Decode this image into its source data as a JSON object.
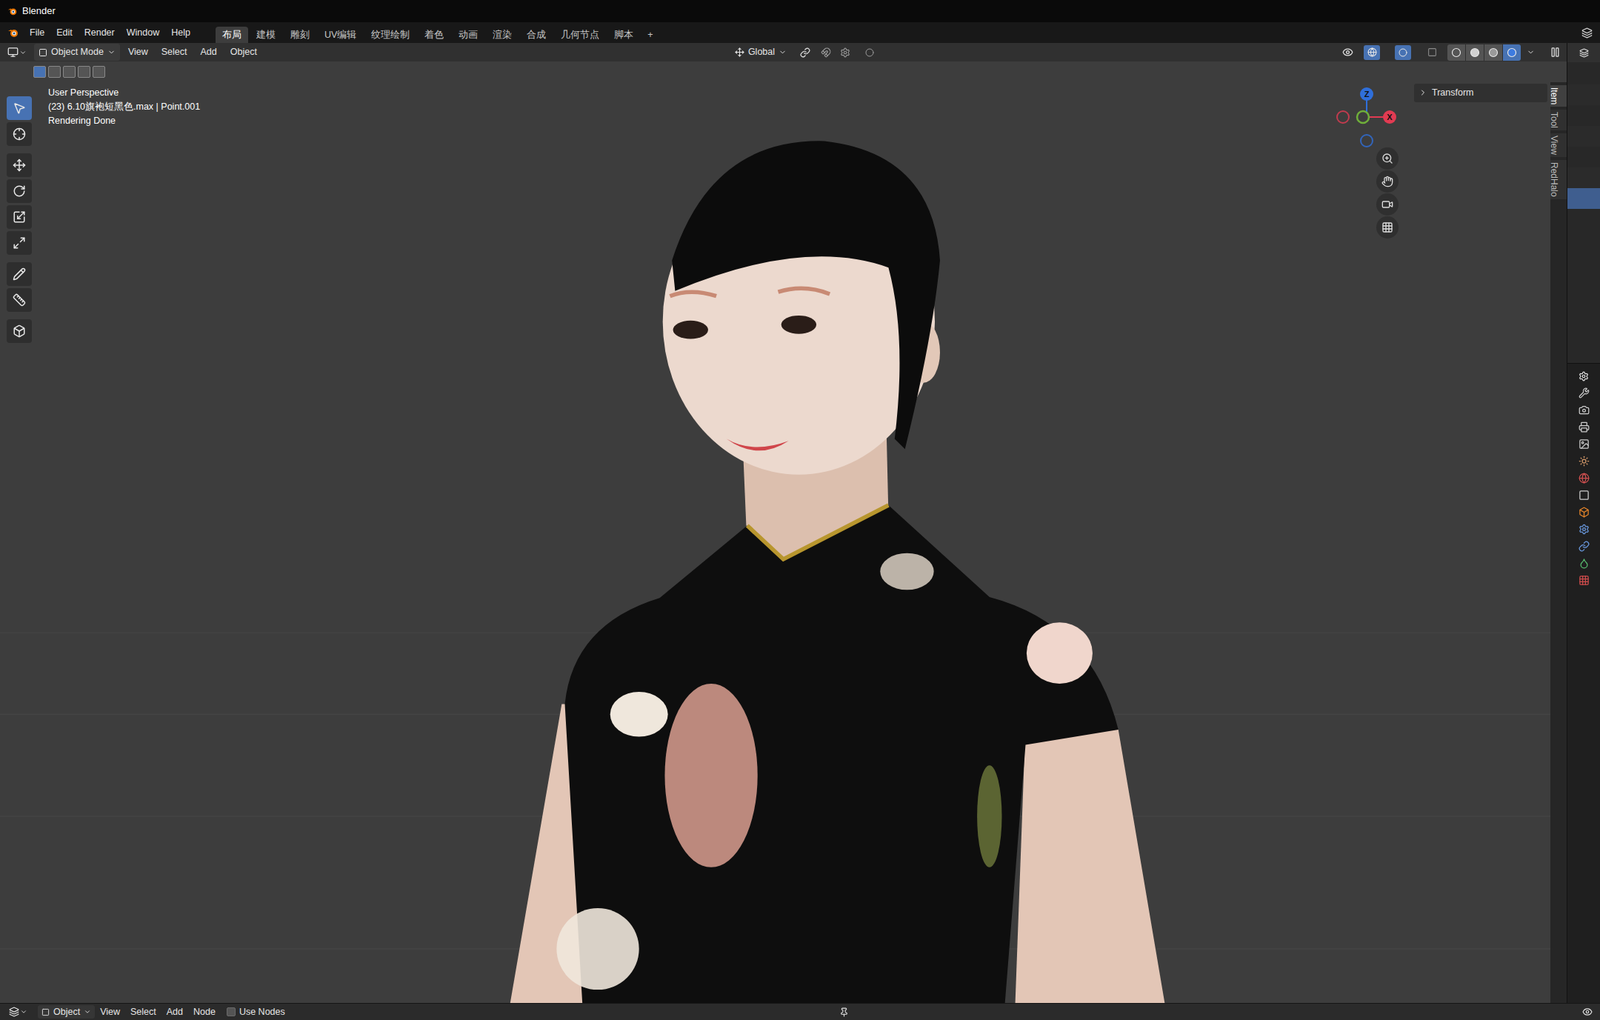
{
  "window": {
    "title": "Blender"
  },
  "menu": [
    "File",
    "Edit",
    "Render",
    "Window",
    "Help"
  ],
  "workspaces": [
    {
      "label": "布局",
      "selected": true
    },
    {
      "label": "建模",
      "selected": false
    },
    {
      "label": "雕刻",
      "selected": false
    },
    {
      "label": "UV编辑",
      "selected": false
    },
    {
      "label": "纹理绘制",
      "selected": false
    },
    {
      "label": "着色",
      "selected": false
    },
    {
      "label": "动画",
      "selected": false
    },
    {
      "label": "渲染",
      "selected": false
    },
    {
      "label": "合成",
      "selected": false
    },
    {
      "label": "几何节点",
      "selected": false
    },
    {
      "label": "脚本",
      "selected": false
    }
  ],
  "add_workspace": "+",
  "viewport_header": {
    "mode": "Object Mode",
    "menus": [
      "View",
      "Select",
      "Add",
      "Object"
    ],
    "orientation": "Global",
    "options": "Options",
    "shading": [
      {
        "kind": "wireframe",
        "selected": false
      },
      {
        "kind": "solid",
        "selected": false
      },
      {
        "kind": "material",
        "selected": false
      },
      {
        "kind": "rendered",
        "selected": true
      }
    ]
  },
  "select_modes": [
    {
      "selected": true
    },
    {
      "selected": false
    },
    {
      "selected": false
    },
    {
      "selected": false
    },
    {
      "selected": false
    }
  ],
  "tools": [
    {
      "kind": "select",
      "selected": true
    },
    {
      "kind": "cursor",
      "selected": false
    },
    {
      "kind": "move",
      "selected": false
    },
    {
      "kind": "rotate",
      "selected": false
    },
    {
      "kind": "scale",
      "selected": false
    },
    {
      "kind": "transform",
      "selected": false
    },
    {
      "kind": "annotate",
      "selected": false
    },
    {
      "kind": "measure",
      "selected": false
    },
    {
      "kind": "add-cube",
      "selected": false
    }
  ],
  "overlay": {
    "lines": [
      "User Perspective",
      "(23) 6.10旗袍短黑色.max | Point.001",
      "Rendering Done"
    ]
  },
  "gizmo": {
    "axes": [
      {
        "label": "Z",
        "color": "#2f6fdb"
      },
      {
        "label": "X",
        "color": "#e23b52"
      }
    ]
  },
  "sidebar": {
    "panel": "Transform",
    "tabs": [
      {
        "label": "Item",
        "selected": true
      },
      {
        "label": "Tool",
        "selected": false
      },
      {
        "label": "View",
        "selected": false
      },
      {
        "label": "RedHalo",
        "selected": false
      }
    ]
  },
  "outliner": {
    "rows": [
      {
        "selected": false
      },
      {
        "selected": false
      },
      {
        "selected": false
      },
      {
        "selected": false
      },
      {
        "selected": false
      },
      {
        "selected": false
      },
      {
        "selected": true
      }
    ]
  },
  "bottom_bar": {
    "editor": "Object",
    "menus": [
      "View",
      "Select",
      "Add",
      "Node"
    ],
    "use_nodes": {
      "label": "Use Nodes",
      "checked": false
    }
  }
}
